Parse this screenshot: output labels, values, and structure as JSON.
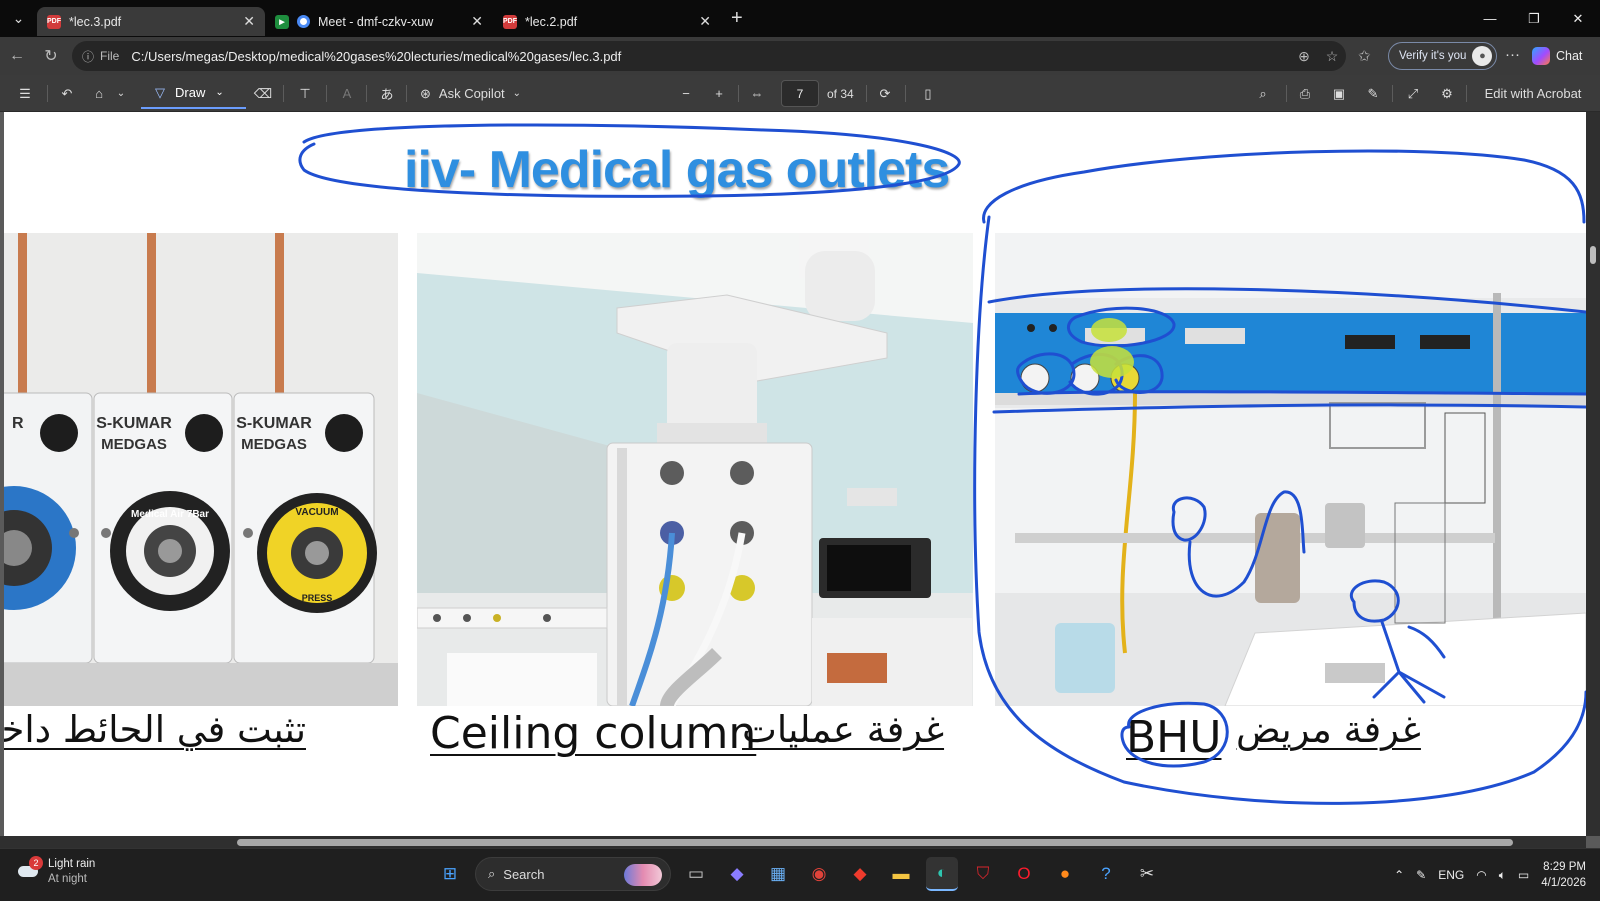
{
  "browser": {
    "tabs": [
      {
        "title": "*lec.3.pdf",
        "active": true,
        "favicon": "pdf-icon"
      },
      {
        "title": "Meet - dmf-czkv-xuw",
        "active": false,
        "favicon": "meet-icon"
      },
      {
        "title": "*lec.2.pdf",
        "active": false,
        "favicon": "pdf-icon"
      }
    ],
    "address": {
      "scheme": "File",
      "url": "C:/Users/megas/Desktop/medical%20gases%20lecturies/medical%20gases/lec.3.pdf"
    },
    "verify_label": "Verify it's you",
    "chat_label": "Chat"
  },
  "pdf_toolbar": {
    "draw_label": "Draw",
    "ask_copilot_label": "Ask Copilot",
    "current_page": "7",
    "page_count": "of 34",
    "edit_label": "Edit with Acrobat"
  },
  "slide": {
    "title": "iiv- Medical gas outlets",
    "captions": {
      "left": "تثبت في الحائط داخل",
      "middle_en": "Ceiling column",
      "middle_ar": "غرفة عمليات",
      "right_en": "BHU",
      "right_ar": "غرفة مريض"
    },
    "left_photo": {
      "panel_brand": "S-KUMAR",
      "panel_sub": "MEDGAS",
      "middle_outlet": "Medical Air 7Bar",
      "right_outlet": "VACUUM",
      "press": "PRESS"
    }
  },
  "taskbar": {
    "weather_title": "Light rain",
    "weather_sub": "At night",
    "weather_badge": "2",
    "search_label": "Search",
    "language": "ENG",
    "time": "8:29 PM",
    "date": "4/1/2026"
  },
  "colors": {
    "ink": "#1f4fd1",
    "title": "#2f8fe0",
    "accent": "#6b9dfd"
  }
}
